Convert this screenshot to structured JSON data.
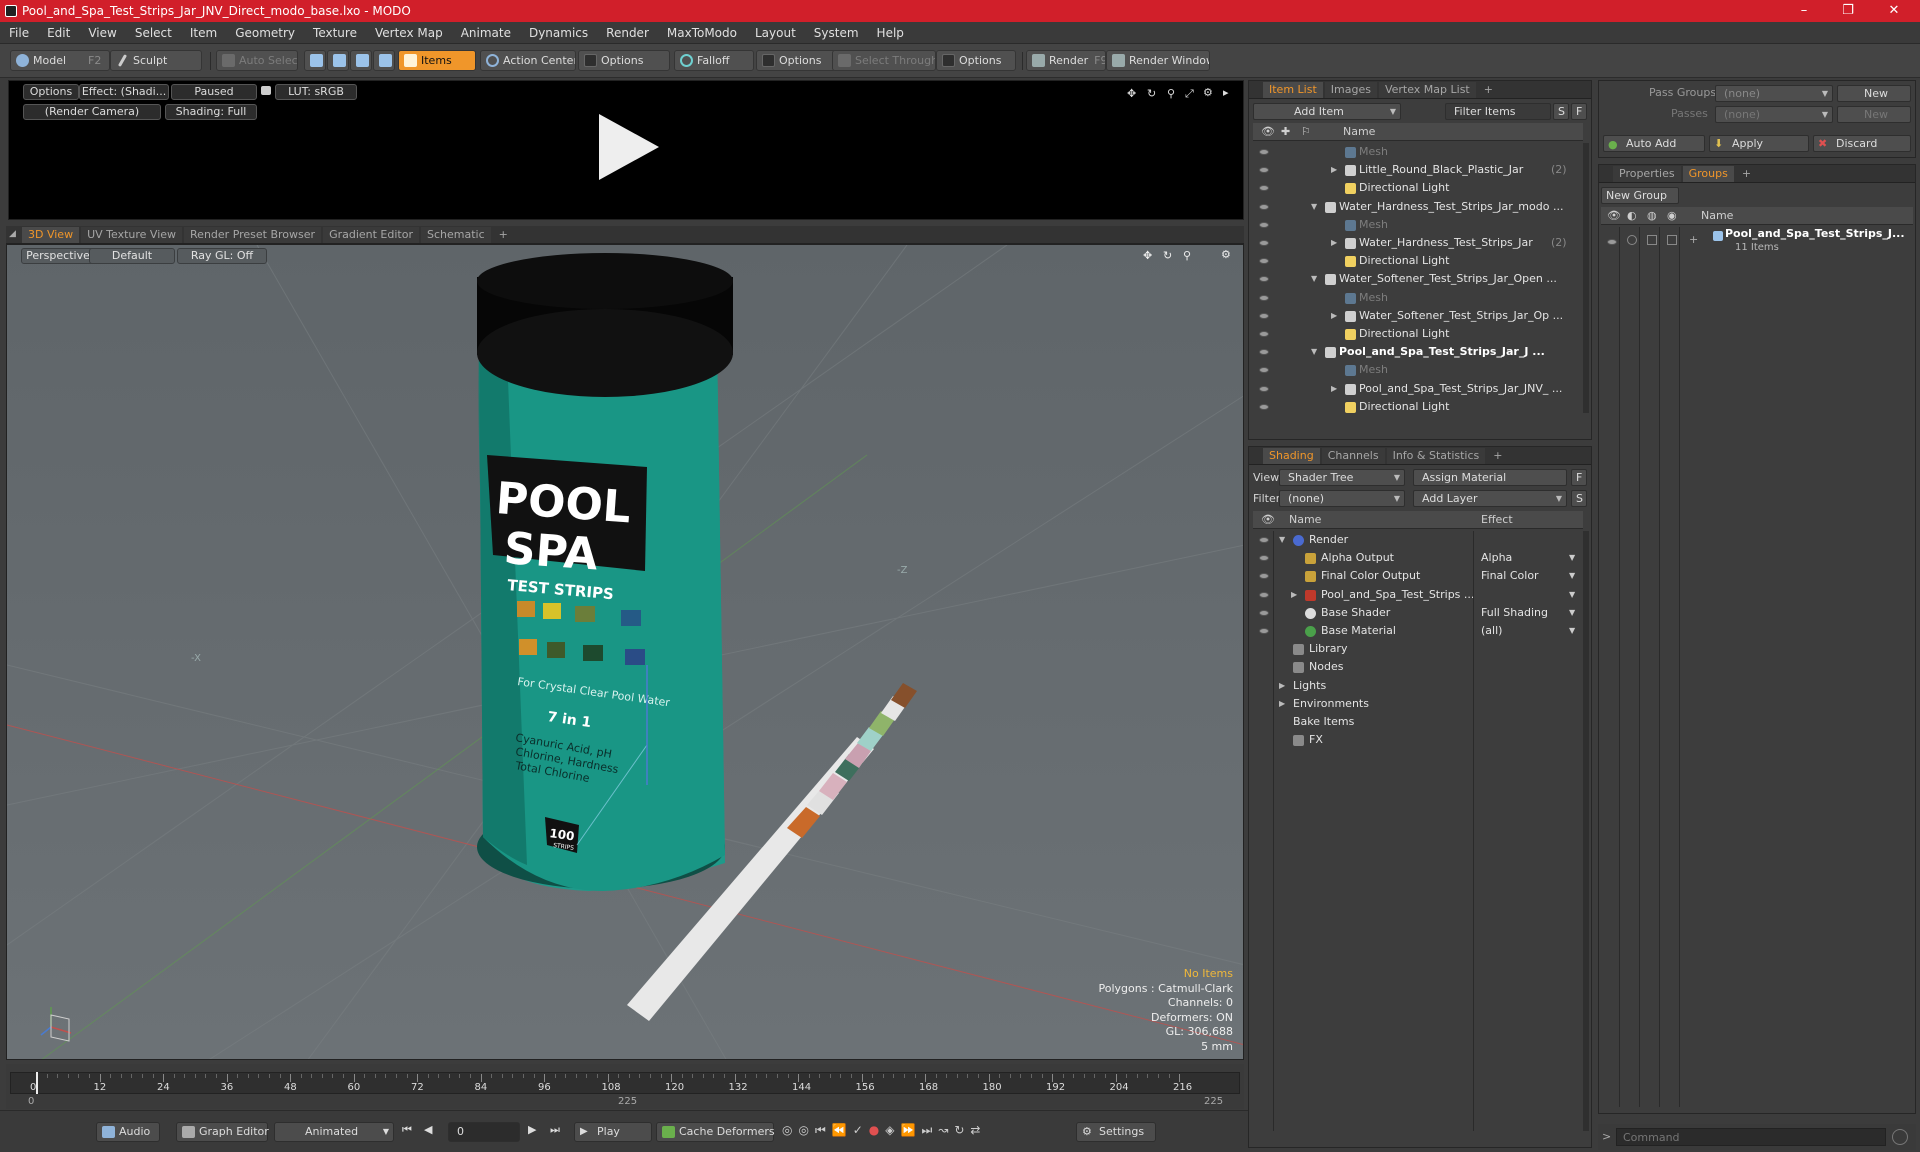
{
  "window": {
    "title": "Pool_and_Spa_Test_Strips_Jar_JNV_Direct_modo_base.lxo - MODO",
    "minimize": "–",
    "maximize": "❐",
    "close": "✕"
  },
  "menu": [
    "File",
    "Edit",
    "View",
    "Select",
    "Item",
    "Geometry",
    "Texture",
    "Vertex Map",
    "Animate",
    "Dynamics",
    "Render",
    "MaxToModo",
    "Layout",
    "System",
    "Help"
  ],
  "toolbar": {
    "model": "Model",
    "model_key": "F2",
    "sculpt": "Sculpt",
    "auto_select": "Auto Select",
    "items": "Items",
    "action_center": "Action Center",
    "options1": "Options",
    "falloff": "Falloff",
    "options2": "Options",
    "select_through": "Select Through",
    "options3": "Options",
    "render": "Render",
    "render_key": "F9",
    "render_window": "Render Window"
  },
  "render_preview": {
    "options": "Options",
    "effect": "Effect: (Shadi...",
    "paused": "Paused",
    "lut": "LUT: sRGB",
    "camera": "(Render Camera)",
    "shading": "Shading: Full"
  },
  "viewport_tabs": [
    "3D View",
    "UV Texture View",
    "Render Preset Browser",
    "Gradient Editor",
    "Schematic",
    "+"
  ],
  "viewport": {
    "perspective": "Perspective",
    "default": "Default",
    "raygl": "Ray GL: Off",
    "axis_x": "-X",
    "axis_z": "-Z",
    "info": [
      "No Items",
      "Polygons : Catmull-Clark",
      "Channels: 0",
      "Deformers: ON",
      "GL: 306,688",
      "5 mm"
    ],
    "label": {
      "pool": "POOL",
      "spa": "SPA",
      "strips": "TEST STRIPS",
      "tag": "For Crystal Clear Pool Water",
      "seven": "7 in 1",
      "desc1": "Cyanuric Acid, pH",
      "desc2": "Chlorine, Hardness",
      "desc3": "Total Chlorine",
      "count": "100",
      "count_unit": "STRIPS"
    }
  },
  "timeline": {
    "ticks": [
      "0",
      "12",
      "24",
      "36",
      "48",
      "60",
      "72",
      "84",
      "96",
      "108",
      "120",
      "132",
      "144",
      "156",
      "168",
      "180",
      "192",
      "204",
      "216"
    ],
    "start": "0",
    "mid": "225",
    "end": "225"
  },
  "bottombar": {
    "audio": "Audio",
    "graph_editor": "Graph Editor",
    "animated": "Animated",
    "frame": "0",
    "play": "Play",
    "cache": "Cache Deformers",
    "settings": "Settings"
  },
  "item_list": {
    "tabs": [
      "Item List",
      "Images",
      "Vertex Map List",
      "+"
    ],
    "add_item": "Add Item",
    "filter": "Filter Items",
    "s": "S",
    "f": "F",
    "name_col": "Name",
    "rows": [
      {
        "label": "Mesh",
        "indent": 3,
        "style": "dim"
      },
      {
        "label": "Little_Round_Black_Plastic_Jar",
        "suffix": "(2)",
        "indent": 3,
        "style": "",
        "arrow": "▶"
      },
      {
        "label": "Directional Light",
        "indent": 3,
        "style": ""
      },
      {
        "label": "Water_Hardness_Test_Strips_Jar_modo ...",
        "indent": 2,
        "style": "",
        "arrow": "▼"
      },
      {
        "label": "Mesh",
        "indent": 3,
        "style": "dim"
      },
      {
        "label": "Water_Hardness_Test_Strips_Jar",
        "suffix": "(2)",
        "indent": 3,
        "style": "",
        "arrow": "▶"
      },
      {
        "label": "Directional Light",
        "indent": 3,
        "style": ""
      },
      {
        "label": "Water_Softener_Test_Strips_Jar_Open ...",
        "indent": 2,
        "style": "",
        "arrow": "▼"
      },
      {
        "label": "Mesh",
        "indent": 3,
        "style": "dim"
      },
      {
        "label": "Water_Softener_Test_Strips_Jar_Op ...",
        "indent": 3,
        "style": "",
        "arrow": "▶"
      },
      {
        "label": "Directional Light",
        "indent": 3,
        "style": ""
      },
      {
        "label": "Pool_and_Spa_Test_Strips_Jar_J ...",
        "indent": 2,
        "style": "bold",
        "arrow": "▼"
      },
      {
        "label": "Mesh",
        "indent": 3,
        "style": "dim"
      },
      {
        "label": "Pool_and_Spa_Test_Strips_Jar_JNV_ ...",
        "indent": 3,
        "style": "",
        "arrow": "▶"
      },
      {
        "label": "Directional Light",
        "indent": 3,
        "style": ""
      }
    ]
  },
  "shading": {
    "tabs": [
      "Shading",
      "Channels",
      "Info & Statistics",
      "+"
    ],
    "view_label": "View",
    "view_value": "Shader Tree",
    "assign_material": "Assign Material",
    "f": "F",
    "filter_label": "Filter",
    "filter_value": "(none)",
    "add_layer": "Add Layer",
    "s": "S",
    "name_col": "Name",
    "effect_col": "Effect",
    "rows": [
      {
        "label": "Render",
        "effect": "",
        "indent": 0,
        "arrow": "▼",
        "eye": true,
        "icon": "#4a6ad0"
      },
      {
        "label": "Alpha Output",
        "effect": "Alpha",
        "indent": 1,
        "eye": true,
        "icon": "#c9a23a"
      },
      {
        "label": "Final Color Output",
        "effect": "Final Color",
        "indent": 1,
        "eye": true,
        "icon": "#c9a23a"
      },
      {
        "label": "Pool_and_Spa_Test_Strips ...",
        "effect": "",
        "indent": 1,
        "arrow": "▶",
        "eye": true,
        "icon": "#c0392b"
      },
      {
        "label": "Base Shader",
        "effect": "Full Shading",
        "indent": 1,
        "eye": true,
        "icon": "#dcdcdc"
      },
      {
        "label": "Base Material",
        "effect": "(all)",
        "indent": 1,
        "eye": true,
        "icon": "#4aa04a"
      },
      {
        "label": "Library",
        "effect": "",
        "indent": 0,
        "eye": false,
        "icon": "#8a8a8a"
      },
      {
        "label": "Nodes",
        "effect": "",
        "indent": 0,
        "eye": false,
        "icon": "#8a8a8a"
      },
      {
        "label": "Lights",
        "effect": "",
        "indent": 0,
        "arrow": "▶",
        "eye": false,
        "icon": ""
      },
      {
        "label": "Environments",
        "effect": "",
        "indent": 0,
        "arrow": "▶",
        "eye": false,
        "icon": ""
      },
      {
        "label": "Bake Items",
        "effect": "",
        "indent": 0,
        "eye": false,
        "icon": ""
      },
      {
        "label": "FX",
        "effect": "",
        "indent": 0,
        "eye": false,
        "icon": "#8a8a8a"
      }
    ]
  },
  "passes": {
    "pass_groups_label": "Pass Groups",
    "pass_groups_value": "(none)",
    "new": "New",
    "passes_label": "Passes",
    "passes_value": "(none)",
    "new2": "New",
    "auto_add": "Auto Add",
    "apply": "Apply",
    "discard": "Discard"
  },
  "groups": {
    "tabs": [
      "Properties",
      "Groups",
      "+"
    ],
    "new_group": "New Group",
    "name_col": "Name",
    "group_name": "Pool_and_Spa_Test_Strips_J...",
    "group_count": "11 Items"
  },
  "command": {
    "placeholder": "Command"
  },
  "colors": {
    "accent": "#f0962a",
    "title_red": "#d11f2a"
  }
}
